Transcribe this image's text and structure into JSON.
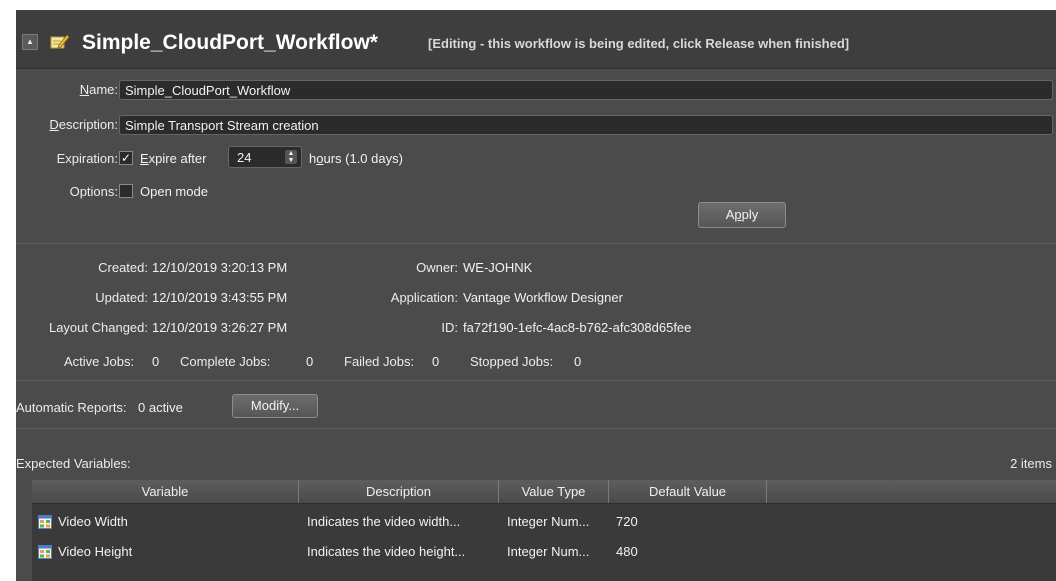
{
  "header": {
    "title": "Simple_CloudPort_Workflow*",
    "subtitle": "[Editing - this workflow is being edited, click Release when finished]",
    "collapse_glyph": "▲",
    "icon": "workflow-edit-icon"
  },
  "form": {
    "name_label": "Name:",
    "name_value": "Simple_CloudPort_Workflow",
    "description_label": "Description:",
    "description_value": "Simple Transport Stream creation",
    "expiration_label": "Expiration:",
    "expire_label": "Expire after",
    "expire_checked": true,
    "expire_value": "24",
    "hours_label": "hours (1.0 days)",
    "options_label": "Options:",
    "open_mode_label": "Open mode",
    "open_mode_checked": false,
    "apply_label": "Apply"
  },
  "info": {
    "created_label": "Created:",
    "created_value": "12/10/2019 3:20:13 PM",
    "updated_label": "Updated:",
    "updated_value": "12/10/2019 3:43:55 PM",
    "layout_label": "Layout Changed:",
    "layout_value": "12/10/2019 3:26:27 PM",
    "owner_label": "Owner:",
    "owner_value": "WE-JOHNK",
    "application_label": "Application:",
    "application_value": "Vantage Workflow Designer",
    "id_label": "ID:",
    "id_value": "fa72f190-1efc-4ac8-b762-afc308d65fee"
  },
  "jobs": {
    "active_label": "Active Jobs:",
    "active_value": "0",
    "complete_label": "Complete Jobs:",
    "complete_value": "0",
    "failed_label": "Failed Jobs:",
    "failed_value": "0",
    "stopped_label": "Stopped Jobs:",
    "stopped_value": "0"
  },
  "reports": {
    "label": "Automatic Reports:",
    "value": "0 active",
    "modify_label": "Modify..."
  },
  "variables": {
    "title": "Expected Variables:",
    "count": "2 items",
    "columns": [
      "Variable",
      "Description",
      "Value Type",
      "Default Value"
    ],
    "rows": [
      {
        "variable": "Video Width",
        "description": "Indicates the video width...",
        "value_type": "Integer Num...",
        "default_value": "720"
      },
      {
        "variable": "Video Height",
        "description": "Indicates the video height...",
        "value_type": "Integer Num...",
        "default_value": "480"
      }
    ]
  },
  "colors": {
    "panel_bg": "#4b4b4b",
    "header_bg": "#3e3e3e",
    "field_bg": "#2b2b2b",
    "text": "#f2f2f2"
  }
}
